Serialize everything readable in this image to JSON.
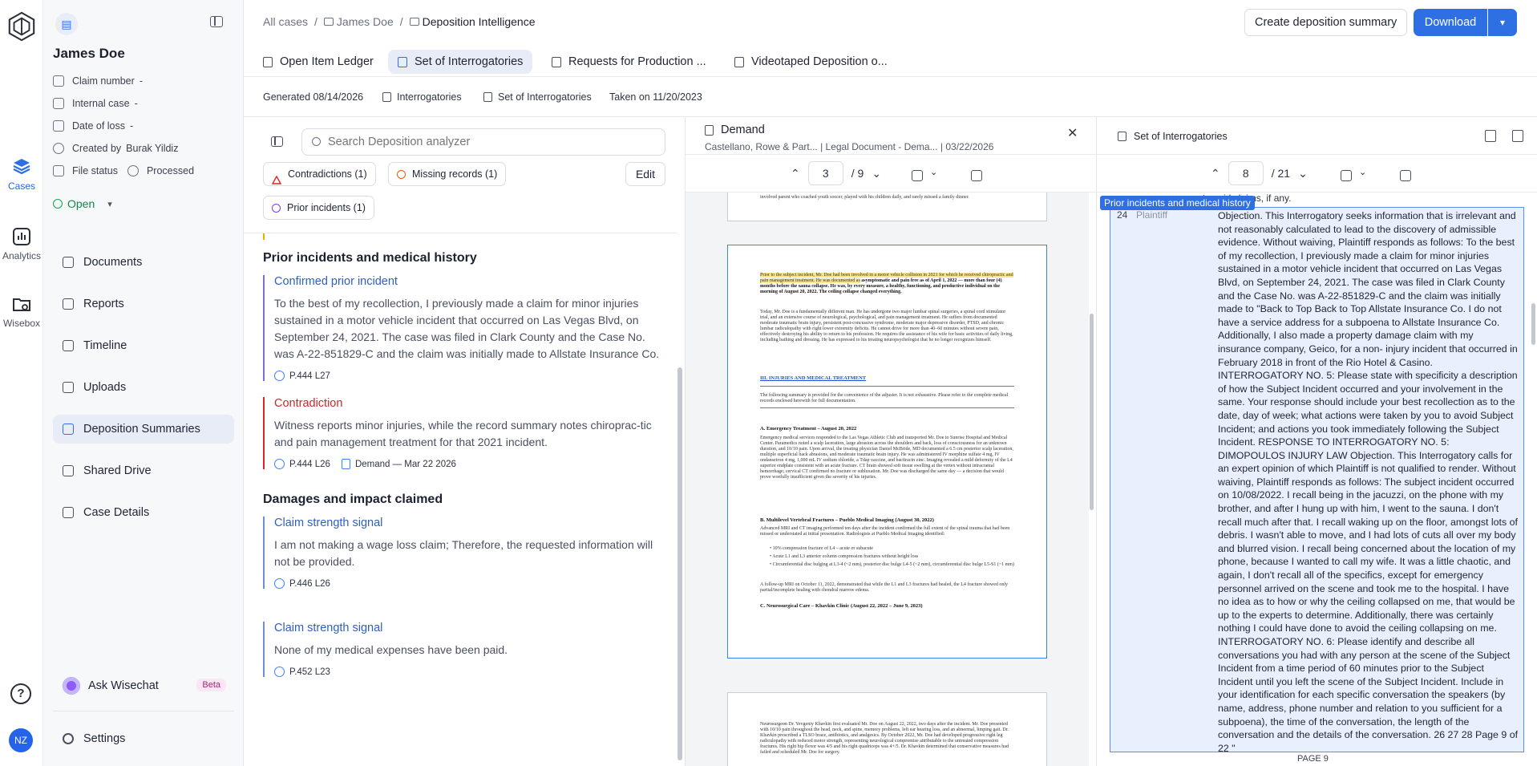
{
  "rail": {
    "items": [
      {
        "label": "Cases"
      },
      {
        "label": "Analytics"
      },
      {
        "label": "Wisebox"
      }
    ],
    "help_glyph": "?",
    "avatar_initials": "NZ"
  },
  "case": {
    "name": "James Doe",
    "meta": [
      {
        "label": "Claim number",
        "value": "-"
      },
      {
        "label": "Internal case",
        "value": "-"
      },
      {
        "label": "Date of loss",
        "value": "-"
      },
      {
        "label": "Created by",
        "value": "Burak Yildiz"
      },
      {
        "label": "File status",
        "value": "Processed"
      }
    ],
    "status": "Open",
    "nav": [
      {
        "label": "Documents"
      },
      {
        "label": "Reports"
      },
      {
        "label": "Timeline"
      },
      {
        "label": "Uploads"
      },
      {
        "label": "Deposition Summaries"
      },
      {
        "label": "Shared Drive"
      },
      {
        "label": "Case Details"
      }
    ],
    "wisechat": {
      "label": "Ask Wisechat",
      "badge": "Beta"
    },
    "settings": "Settings"
  },
  "breadcrumb": {
    "root": "All cases",
    "case": "James Doe",
    "current": "Deposition Intelligence",
    "sep": "/"
  },
  "actions": {
    "create_summary": "Create deposition summary",
    "download": "Download"
  },
  "tabs": [
    {
      "label": "Open Item Ledger"
    },
    {
      "label": "Set of Interrogatories"
    },
    {
      "label": "Requests for Production ..."
    },
    {
      "label": "Videotaped Deposition o..."
    }
  ],
  "subinfo": {
    "generated": "Generated 08/14/2026",
    "doc1": "Interrogatories",
    "doc2": "Set of Interrogatories",
    "taken": "Taken on 11/20/2023"
  },
  "analyzer": {
    "search_placeholder": "Search Deposition analyzer",
    "filters": [
      {
        "label": "Contradictions (1)"
      },
      {
        "label": "Missing records (1)"
      },
      {
        "label": "Prior incidents (1)"
      }
    ],
    "edit": "Edit",
    "sections": [
      {
        "title": "Prior incidents and medical history",
        "findings": [
          {
            "title": "Confirmed prior incident",
            "body": "To the best of my recollection, I previously made a claim for minor injuries sustained in a motor vehicle incident that occurred on Las Vegas Blvd, on September 24, 2021. The case was filed in Clark County and the Case No. was A-22-851829-C and the claim was initially made to Allstate Insurance Co.",
            "refs": [
              "P.444 L27"
            ]
          },
          {
            "title": "Contradiction",
            "body": "Witness reports minor injuries, while the record summary notes chiroprac-tic and pain management treatment for that 2021 incident.",
            "refs": [
              "P.444 L26"
            ],
            "doc_ref": "Demand — Mar 22 2026"
          }
        ]
      },
      {
        "title": "Damages and impact claimed",
        "findings": [
          {
            "title": "Claim strength signal",
            "body": "I am not making a wage loss claim; Therefore, the requested information will not be provided.",
            "refs": [
              "P.446 L26"
            ]
          },
          {
            "title": "Claim strength signal",
            "body": "None of my medical expenses have been paid.",
            "refs": [
              "P.452 L23"
            ]
          }
        ]
      }
    ]
  },
  "demand": {
    "title": "Demand",
    "subtitle": "Castellano, Rowe & Part...  |  Legal Document - Dema...  |  03/22/2026",
    "page": "3",
    "total": "/ 9",
    "page1_tail": "involved parent who coached youth soccer, played with his children daily, and rarely missed a family dinner.",
    "p2_intro_hl": "Prior to the subject incident, Mr. Doe had been involved in a motor vehicle collision in 2021 for which he received chiropractic and pain management treatment. He was documented as",
    "p2_intro_rest": "asymptomatic and pain free as of April 1, 2022 — more than four (4) months before the sauna collapse. He was, by every measure, a healthy, functioning, and productive individual on the morning of August 20, 2022. The ceiling collapse changed everything.",
    "p2_para2": "Today, Mr. Doe is a fundamentally different man. He has undergone two major lumbar spinal surgeries, a spinal cord stimulator trial, and an extensive course of neurological, psychological, and pain management treatment. He suffers from documented moderate traumatic brain injury, persistent post-concussive syndrome, moderate major depressive disorder, PTSD, and chronic lumbar radiculopathy with right lower extremity deficits. He cannot drive for more than 40–60 minutes without severe pain, effectively destroying his ability to return to his profession. He requires the assistance of his wife for basic activities of daily living, including bathing and dressing. He has expressed to his treating neuropsychologist that he no longer recognizes himself.",
    "p2_heading": "III.  INJURIES AND MEDICAL TREATMENT",
    "p2_note": "The following summary is provided for the convenience of the adjuster. It is not exhaustive. Please refer to the complete medical records enclosed herewith for full documentation.",
    "p2_a_head": "A.  Emergency Treatment – August 20, 2022",
    "p2_a_body": "Emergency medical services responded to the Las Vegas Athletic Club and transported Mr. Doe to Sunrise Hospital and Medical Center. Paramedics noted a scalp laceration, large abrasion across the shoulders and back, loss of consciousness for an unknown duration, and 10/10 pain. Upon arrival, the treating physician Daniel McBride, MD documented a 6.5 cm posterior scalp laceration, multiple superficial back abrasions, and moderate traumatic brain injury. He was administered IV morphine sulfate 4 mg, IV ondansetron 4 mg, 1,000 mL IV sodium chloride, a Tdap vaccine, and bacitracin zinc. Imaging revealed a mild deformity of the L4 superior endplate consistent with an acute fracture. CT brain showed soft tissue swelling at the vertex without intracranial hemorrhage; cervical CT confirmed no fracture or subluxation. Mr. Doe was discharged the same day — a decision that would prove woefully insufficient given the severity of his injuries.",
    "p2_b_head": "B.  Multilevel Vertebral Fractures – Pueblo Medical Imaging (August 30, 2022)",
    "p2_b_body": "Advanced MRI and CT imaging performed ten days after the incident confirmed the full extent of the spinal trauma that had been missed or understated at initial presentation. Radiologists at Pueblo Medical Imaging identified:",
    "p2_bullets": [
      "10% compression fracture of L4 – acute or subacute",
      "Acute L1 and L3 anterior column compression fractures without height loss",
      "Circumferential disc bulging at L3-4 (~2 mm), posterior disc bulge L4-5 (~2 mm), circumferential disc bulge L5-S1 (~1 mm)"
    ],
    "p2_b_tail": "A follow-up MRI on October 11, 2022, demonstrated that while the L1 and L3 fractures had healed, the L4 fracture showed only partial/incomplete healing with chondral marrow edema.",
    "p2_c_head": "C.  Neurosurgical Care – Khavkin Clinic (August 22, 2022 – June 9, 2023)",
    "p3_body": "Neurosurgeon Dr. Yevgeniy Khavkin first evaluated Mr. Doe on August 22, 2022, two days after the incident. Mr. Doe presented with 10/10 pain throughout the head, neck, and spine, memory problems, left ear hearing loss, and an abnormal, limping gait. Dr. Khavkin prescribed a TLSO brace, antibiotics, and analgesics. By October 2022, Mr. Doe had developed progressive right leg radiculopathy with reduced motor strength, representing neurological compromise attributable to the untreated compression fractures. His right hip flexor was 4/5 and his right quadriceps was 4+/5. Dr. Khavkin determined that conservative measures had failed and scheduled Mr. Doe for surgery."
  },
  "interrogatories": {
    "title": "Set of Interrogatories",
    "page": "8",
    "total": "/ 21",
    "cutoff_line": "to said claims, if any.",
    "tag": "Prior incidents and medical history",
    "line_no": "24",
    "speaker": "Plaintiff",
    "text": "Objection. This Interrogatory seeks information that is irrelevant and not reasonably calculated to lead to the discovery of admissible evidence. Without waiving, Plaintiff responds as follows: To the best of my recollection, I previously made a claim for minor injuries sustained in a motor vehicle incident that occurred on Las Vegas Blvd, on September 24, 2021. The case was filed in Clark County and the Case No. was A-22-851829-C and the claim was initially made to \"Back to Top Back to Top Allstate Insurance Co. I do not have a service address for a subpoena to Allstate Insurance Co. Additionally, I also made a property damage claim with my insurance company, Geico, for a non- injury incident that occurred in February 2018 in front of the Rio Hotel & Casino. INTERROGATORY NO. 5: Please state with specificity a description of how the Subject Incident occurred and your involvement in the same. Your response should include your best recollection as to the date, day of week; what actions were taken by you to avoid Subject Incident; and actions you took immediately following the Subject Incident. RESPONSE TO INTERROGATORY NO. 5: DIMOPOULOS INJURY LAW Objection. This Interrogatory calls for an expert opinion of which Plaintiff is not qualified to render. Without waiving, Plaintiff responds as follows: The subject incident occurred on 10/08/2022. I recall being in the jacuzzi, on the phone with my brother, and after I hung up with him, I went to the sauna. I don't recall much after that. I recall waking up on the floor, amongst lots of debris. I wasn't able to move, and I had lots of cuts all over my body and blurred vision. I recall being concerned about the location of my phone, because I wanted to call my wife. It was a little chaotic, and again, I don't recall all of the specifics, except for emergency personnel arrived on the scene and took me to the hospital. I have no idea as to how or why the ceiling collapsed on me, that would be up to the experts to determine. Additionally, there was certainly nothing I could have done to avoid the ceiling collapsing on me. INTERROGATORY NO. 6: Please identify and describe all conversations you had with any person at the scene of the Subject Incident from a time period of 60 minutes prior to the Subject Incident until you left the scene of the Subject Incident. Include in your identification for each specific conversation the speakers (by name, address, phone number and relation to you sufficient for a subpoena), the time of the conversation, the length of the conversation and the details of the conversation. 26 27 28 Page 9 of 22 \"",
    "footer": "PAGE 9"
  },
  "colors": {
    "accent": "#2f6fe4",
    "active_bg": "#e7ecf6",
    "highlight": "#fbe58a",
    "contradiction": "#dc2626",
    "open_status": "#16a34a"
  }
}
